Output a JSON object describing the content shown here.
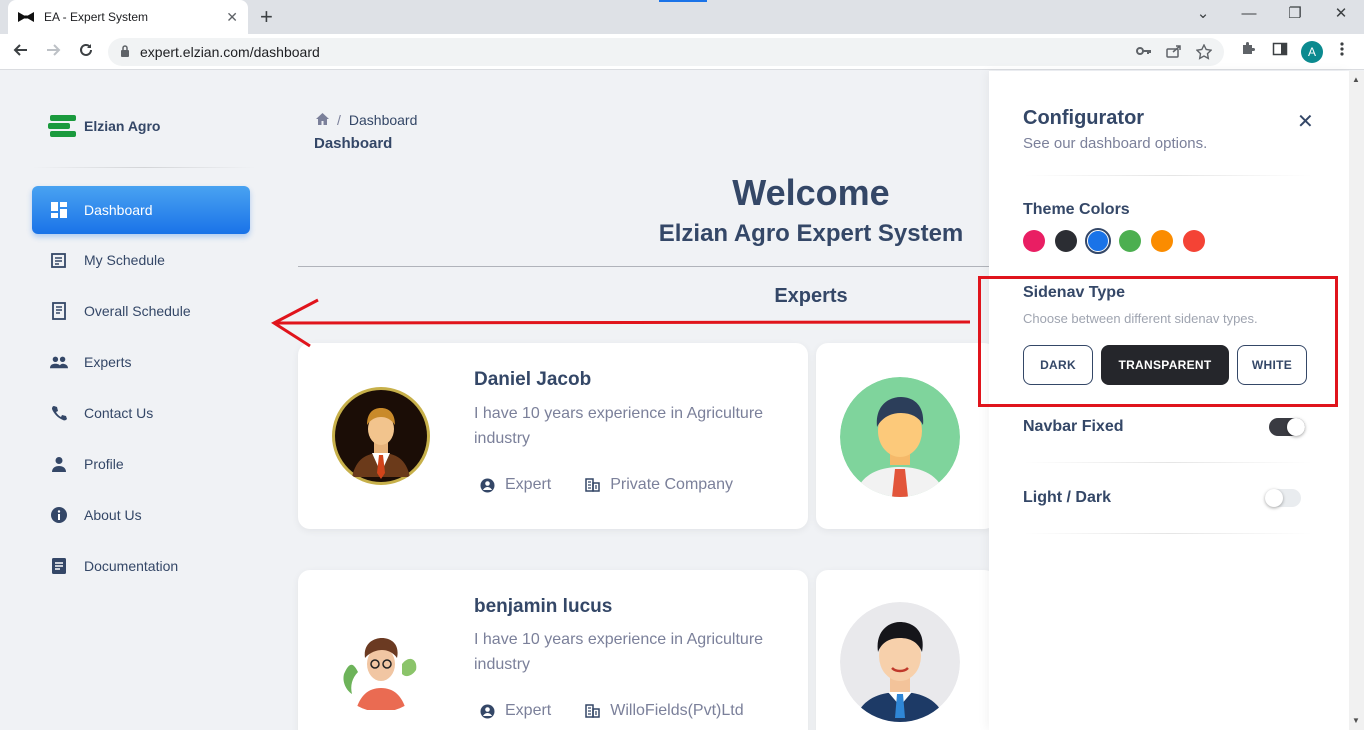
{
  "browser": {
    "tab_title": "EA - Expert System",
    "url": "expert.elzian.com/dashboard",
    "profile_initial": "A",
    "close_tab": "✕",
    "new_tab": "+",
    "minimize": "⌄",
    "restore": "—",
    "maximize": "❐",
    "close": "✕"
  },
  "sidebar": {
    "brand": "Elzian Agro",
    "items": [
      {
        "label": "Dashboard",
        "icon": "dashboard-icon"
      },
      {
        "label": "My Schedule",
        "icon": "calendar-icon"
      },
      {
        "label": "Overall Schedule",
        "icon": "receipt-icon"
      },
      {
        "label": "Experts",
        "icon": "people-icon"
      },
      {
        "label": "Contact Us",
        "icon": "phone-icon"
      },
      {
        "label": "Profile",
        "icon": "person-icon"
      },
      {
        "label": "About Us",
        "icon": "info-icon"
      },
      {
        "label": "Documentation",
        "icon": "document-icon"
      }
    ]
  },
  "main": {
    "breadcrumb": {
      "separator": "/",
      "current": "Dashboard"
    },
    "page_title": "Dashboard",
    "welcome": "Welcome",
    "subtitle": "Elzian Agro Expert System",
    "experts_heading": "Experts",
    "experts": [
      {
        "name": "Daniel Jacob",
        "desc": "I have 10 years experience in Agriculture industry",
        "role": "Expert",
        "company": "Private Company"
      },
      {
        "name": "benjamin lucus",
        "desc": "I have 10 years experience in Agriculture industry",
        "role": "Expert",
        "company": "WilloFields(Pvt)Ltd"
      }
    ]
  },
  "configurator": {
    "title": "Configurator",
    "subtitle": "See our dashboard options.",
    "close": "✕",
    "theme_colors_label": "Theme Colors",
    "theme_colors": [
      "#e91e63",
      "#2b2d33",
      "#1a73e8",
      "#4caf50",
      "#fb8c00",
      "#f44335"
    ],
    "selected_theme_color": "#1a73e8",
    "sidenav_type_label": "Sidenav Type",
    "sidenav_type_desc": "Choose between different sidenav types.",
    "sidenav_buttons": [
      "DARK",
      "TRANSPARENT",
      "WHITE"
    ],
    "sidenav_selected": "TRANSPARENT",
    "navbar_fixed_label": "Navbar Fixed",
    "navbar_fixed": true,
    "light_dark_label": "Light / Dark",
    "light_dark": false
  },
  "colors": {
    "accent": "#1a73e8",
    "text": "#344767",
    "muted": "#7b809a",
    "annotation": "#e0141c"
  }
}
